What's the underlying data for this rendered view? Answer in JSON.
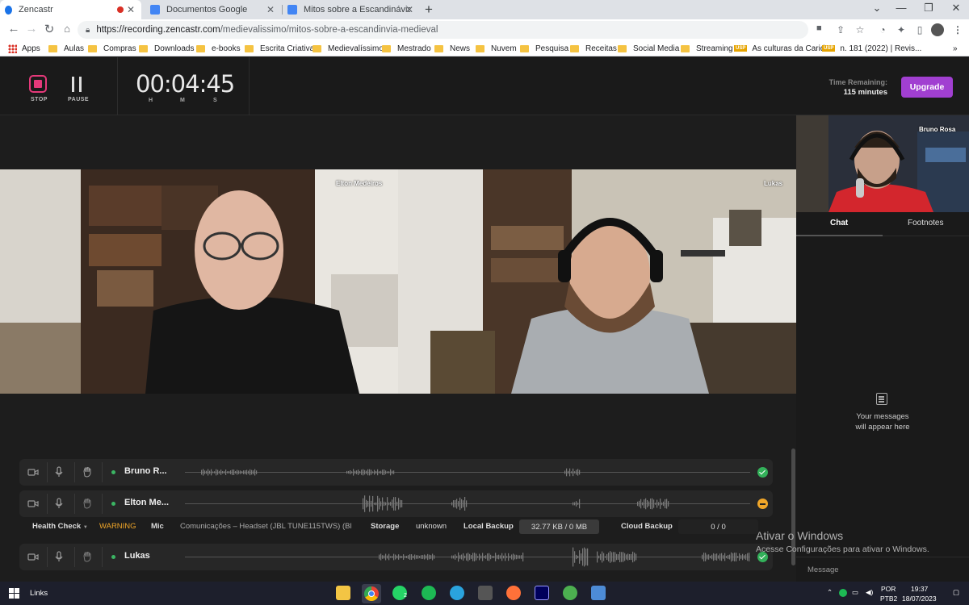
{
  "browser": {
    "tabs": [
      {
        "title": "Zencastr",
        "active": true
      },
      {
        "title": "Documentos Google",
        "active": false
      },
      {
        "title": "Mitos sobre a Escandinávia Medie",
        "active": false
      }
    ],
    "url_host": "https://recording.zencastr.com",
    "url_path": "/medievalissimo/mitos-sobre-a-escandinvia-medieval",
    "bookmarks": [
      "Apps",
      "Aulas",
      "Compras",
      "Downloads",
      "e-books",
      "Escrita Criativa",
      "Medievalíssimo",
      "Mestrado",
      "News",
      "Nuvem",
      "Pesquisa",
      "Receitas",
      "Social Media",
      "Streaming",
      "As culturas da Carid...",
      "n. 181 (2022) | Revis..."
    ],
    "usp_badge": "USP"
  },
  "recorder": {
    "stop_label": "STOP",
    "pause_label": "PAUSE",
    "timer": "00:04:45",
    "timer_units": [
      "H",
      "M",
      "S"
    ],
    "time_remaining_label": "Time Remaining:",
    "time_remaining_value": "115 minutes",
    "upgrade_label": "Upgrade"
  },
  "videos": [
    {
      "name": "Elton Medeiros"
    },
    {
      "name": "Lukas"
    },
    {
      "name": "Bruno Rosa"
    }
  ],
  "sidepanel": {
    "tabs": [
      "Chat",
      "Footnotes"
    ],
    "empty_line1": "Your messages",
    "empty_line2": "will appear here",
    "message_placeholder": "Message"
  },
  "tracks": [
    {
      "name": "Bruno R...",
      "status": "ok"
    },
    {
      "name": "Elton Me...",
      "status": "warning"
    },
    {
      "name": "Lukas",
      "status": "ok"
    }
  ],
  "health": {
    "label": "Health Check",
    "status": "WARNING",
    "mic_label": "Mic",
    "mic_value": "Comunicações – Headset (JBL TUNE115TWS) (Blu...",
    "storage_label": "Storage",
    "storage_value": "unknown",
    "local_backup_label": "Local Backup",
    "local_backup_value": "32.77 KB / 0 MB",
    "cloud_backup_label": "Cloud Backup",
    "cloud_backup_value": "0 / 0"
  },
  "windows_activation": {
    "line1": "Ativar o Windows",
    "line2": "Acesse Configurações para ativar o Windows."
  },
  "taskbar": {
    "links_label": "Links",
    "whatsapp_badge": "2",
    "language": "POR",
    "keyboard": "PTB2",
    "time": "19:37",
    "date": "18/07/2023"
  },
  "colors": {
    "accent": "#a13fd1",
    "record": "#e5397a",
    "ok": "#33b15a",
    "warning": "#f0a629"
  }
}
